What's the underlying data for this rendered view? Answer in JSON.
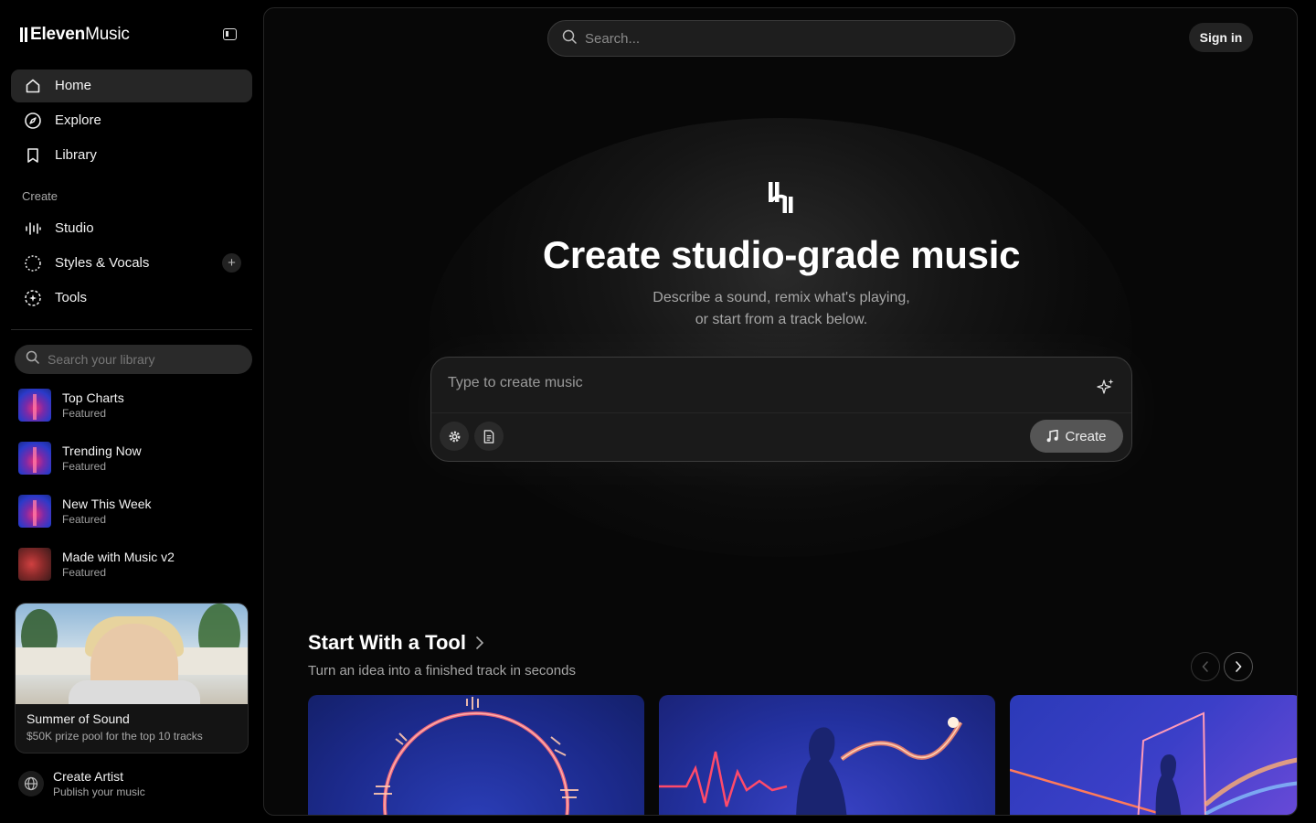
{
  "brand": {
    "bold": "Eleven",
    "light": "Music"
  },
  "nav": {
    "home": "Home",
    "explore": "Explore",
    "library": "Library",
    "create_section": "Create",
    "studio": "Studio",
    "styles": "Styles & Vocals",
    "tools": "Tools"
  },
  "library": {
    "search_placeholder": "Search your library",
    "items": [
      {
        "title": "Top Charts",
        "sub": "Featured"
      },
      {
        "title": "Trending Now",
        "sub": "Featured"
      },
      {
        "title": "New This Week",
        "sub": "Featured"
      },
      {
        "title": "Made with Music v2",
        "sub": "Featured"
      }
    ]
  },
  "promo": {
    "title": "Summer of Sound",
    "sub": "$50K prize pool for the top 10 tracks"
  },
  "create_artist": {
    "title": "Create Artist",
    "sub": "Publish your music"
  },
  "header": {
    "search_placeholder": "Search...",
    "signin": "Sign in"
  },
  "hero": {
    "title": "Create studio-grade music",
    "subtitle": "Describe a sound, remix what's playing, or start from a track below."
  },
  "prompt": {
    "placeholder": "Type to create music",
    "create_label": "Create"
  },
  "tools": {
    "title": "Start With a Tool",
    "subtitle": "Turn an idea into a finished track in seconds"
  },
  "colors": {
    "background": "#000000",
    "panel": "#070707",
    "accent_pink": "#ff5a8a",
    "card_blue": "#2331a0"
  }
}
